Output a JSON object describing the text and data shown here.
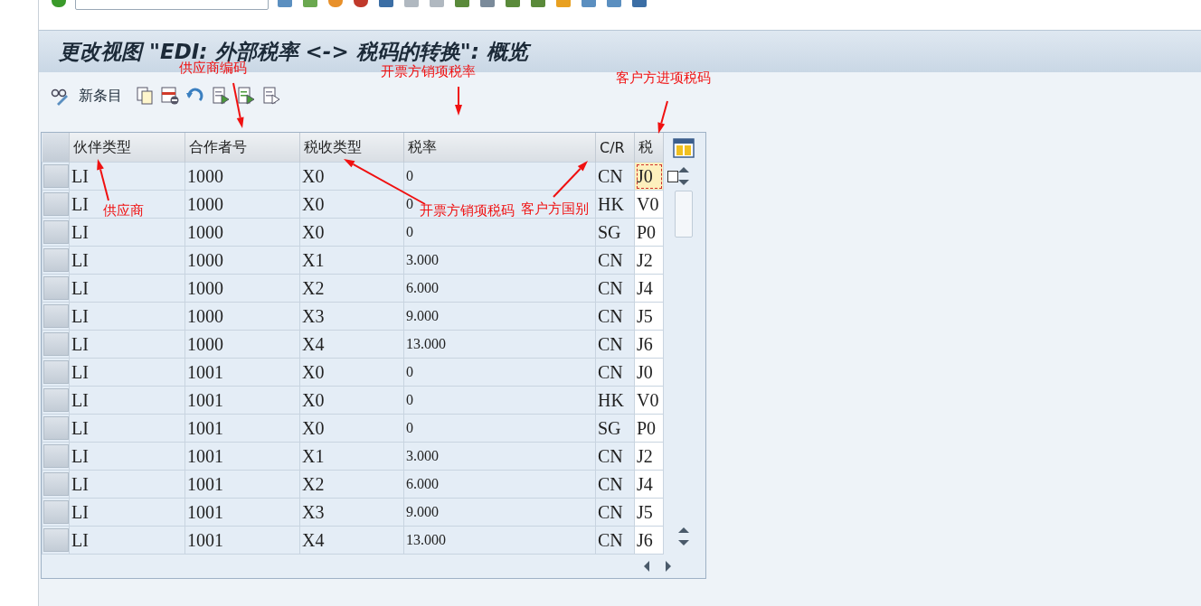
{
  "title": "更改视图 \"EDI: 外部税率 <-> 税码的转换\": 概览",
  "toolbar": {
    "new_entries": "新条目"
  },
  "table": {
    "columns": [
      "伙伴类型",
      "合作者号",
      "税收类型",
      "税率",
      "C/R",
      "税"
    ],
    "rows": [
      {
        "cells": [
          "LI",
          "1000",
          "X0",
          "0",
          "CN",
          "J0"
        ],
        "focused": true
      },
      {
        "cells": [
          "LI",
          "1000",
          "X0",
          "0",
          "HK",
          "V0"
        ],
        "focused": false
      },
      {
        "cells": [
          "LI",
          "1000",
          "X0",
          "0",
          "SG",
          "P0"
        ],
        "focused": false
      },
      {
        "cells": [
          "LI",
          "1000",
          "X1",
          "3.000",
          "CN",
          "J2"
        ],
        "focused": false
      },
      {
        "cells": [
          "LI",
          "1000",
          "X2",
          "6.000",
          "CN",
          "J4"
        ],
        "focused": false
      },
      {
        "cells": [
          "LI",
          "1000",
          "X3",
          "9.000",
          "CN",
          "J5"
        ],
        "focused": false
      },
      {
        "cells": [
          "LI",
          "1000",
          "X4",
          "13.000",
          "CN",
          "J6"
        ],
        "focused": false
      },
      {
        "cells": [
          "LI",
          "1001",
          "X0",
          "0",
          "CN",
          "J0"
        ],
        "focused": false
      },
      {
        "cells": [
          "LI",
          "1001",
          "X0",
          "0",
          "HK",
          "V0"
        ],
        "focused": false
      },
      {
        "cells": [
          "LI",
          "1001",
          "X0",
          "0",
          "SG",
          "P0"
        ],
        "focused": false
      },
      {
        "cells": [
          "LI",
          "1001",
          "X1",
          "3.000",
          "CN",
          "J2"
        ],
        "focused": false
      },
      {
        "cells": [
          "LI",
          "1001",
          "X2",
          "6.000",
          "CN",
          "J4"
        ],
        "focused": false
      },
      {
        "cells": [
          "LI",
          "1001",
          "X3",
          "9.000",
          "CN",
          "J5"
        ],
        "focused": false
      },
      {
        "cells": [
          "LI",
          "1001",
          "X4",
          "13.000",
          "CN",
          "J6"
        ],
        "focused": false
      }
    ]
  },
  "annotations": [
    {
      "text": "供应商编码"
    },
    {
      "text": "开票方销项税率"
    },
    {
      "text": "客户方进项税码"
    },
    {
      "text": "供应商"
    },
    {
      "text": "开票方销项税码"
    },
    {
      "text": "客户方国别"
    }
  ]
}
